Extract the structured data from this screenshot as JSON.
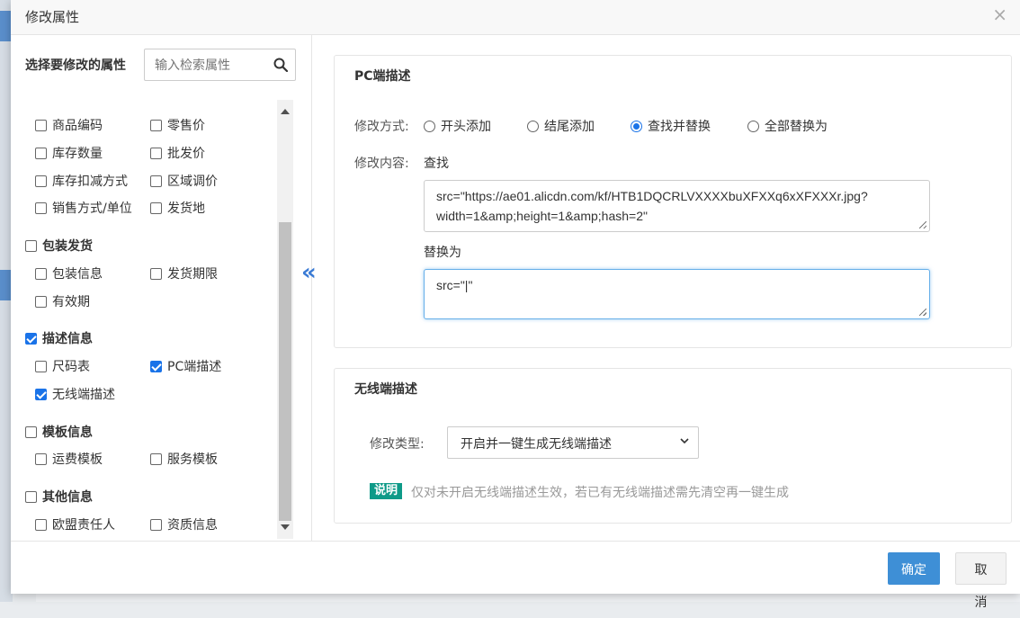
{
  "modal": {
    "title": "修改属性",
    "close_glyph": "×"
  },
  "left": {
    "select_label": "选择要修改的属性",
    "search_placeholder": "输入检索属性",
    "collapse_glyph": "«",
    "items": {
      "shangpin_bianma": "商品编码",
      "lingshou_jia": "零售价",
      "kucun_shuliang": "库存数量",
      "pifa_jia": "批发价",
      "kucun_koujian": "库存扣减方式",
      "quyu_tiaojia": "区域调价",
      "xiaoshou_fangshi": "销售方式/单位",
      "fahuo_di": "发货地",
      "baozhuang_fahuo": "包装发货",
      "baozhuang_xinxi": "包装信息",
      "fahuo_qixian": "发货期限",
      "youxiaoqi": "有效期",
      "miaoshu_xinxi": "描述信息",
      "chima_biao": "尺码表",
      "pc_miaoshu": "PC端描述",
      "wuxian_miaoshu": "无线端描述",
      "muban_xinxi": "模板信息",
      "yunfei_muban": "运费模板",
      "fuwu_muban": "服务模板",
      "qita_xinxi": "其他信息",
      "oumeng_zeren": "欧盟责任人",
      "zizhi_xinxi": "资质信息"
    }
  },
  "pc_section": {
    "title": "PC端描述",
    "mode_label": "修改方式:",
    "modes": [
      "开头添加",
      "结尾添加",
      "查找并替换",
      "全部替换为"
    ],
    "selected_mode": "查找并替换",
    "content_label": "修改内容:",
    "find_label": "查找",
    "find_value": "src=\"https://ae01.alicdn.com/kf/HTB1DQCRLVXXXXbuXFXXq6xXFXXXr.jpg?width=1&amp;height=1&amp;hash=2\"",
    "replace_label": "替换为",
    "replace_value": "src=\"|\""
  },
  "wireless_section": {
    "title": "无线端描述",
    "type_label": "修改类型:",
    "type_value": "开启并一键生成无线端描述",
    "note_badge": "说明",
    "note_text": "仅对未开启无线端描述生效，若已有无线端描述需先清空再一键生成"
  },
  "footer": {
    "ok_label": "确定",
    "cancel_label": "取消"
  },
  "colors": {
    "accent": "#1a73e8",
    "primary_button": "#3e8fd6",
    "note_badge": "#0e9a88"
  }
}
